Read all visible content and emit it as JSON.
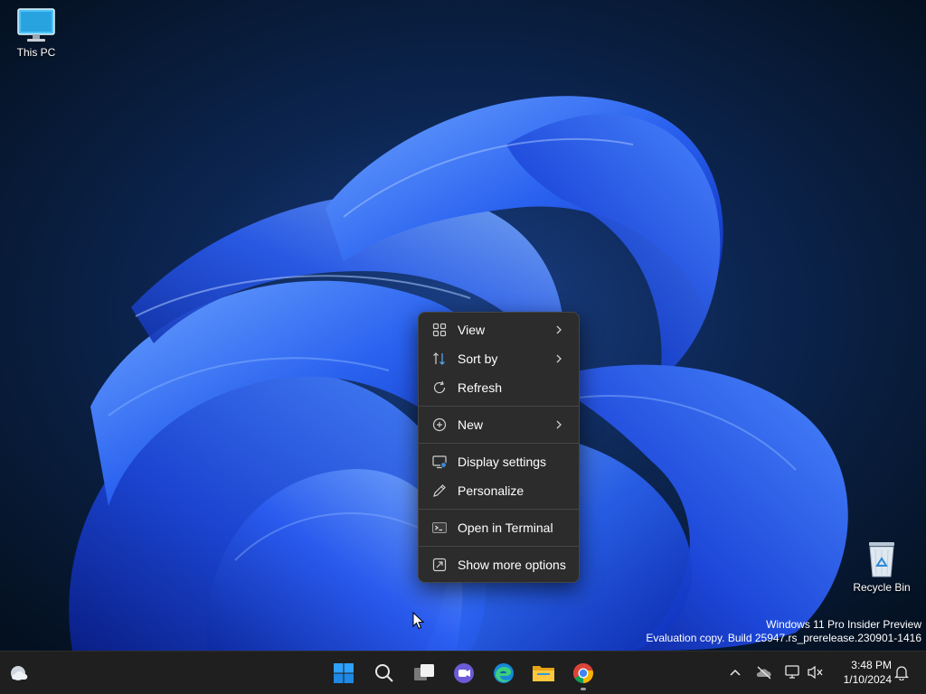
{
  "desktop": {
    "icons": [
      {
        "label": "This PC",
        "icon": "monitor-icon"
      },
      {
        "label": "Recycle Bin",
        "icon": "recycle-bin-icon"
      }
    ],
    "watermark": {
      "line1": "Windows 11 Pro Insider Preview",
      "line2": "Evaluation copy. Build 25947.rs_prerelease.230901-1416"
    }
  },
  "context_menu": {
    "items": [
      {
        "label": "View",
        "icon": "grid-icon",
        "submenu": true
      },
      {
        "label": "Sort by",
        "icon": "sort-icon",
        "submenu": true
      },
      {
        "label": "Refresh",
        "icon": "refresh-icon",
        "submenu": false
      },
      {
        "label": "New",
        "icon": "plus-circle-icon",
        "submenu": true
      },
      {
        "label": "Display settings",
        "icon": "display-settings-icon",
        "submenu": false
      },
      {
        "label": "Personalize",
        "icon": "pen-icon",
        "submenu": false
      },
      {
        "label": "Open in Terminal",
        "icon": "terminal-icon",
        "submenu": false
      },
      {
        "label": "Show more options",
        "icon": "more-options-icon",
        "submenu": false
      }
    ]
  },
  "taskbar": {
    "apps": [
      {
        "name": "Start",
        "icon": "windows-start-icon"
      },
      {
        "name": "Search",
        "icon": "search-icon"
      },
      {
        "name": "Task View",
        "icon": "task-view-icon"
      },
      {
        "name": "Chat",
        "icon": "chat-icon"
      },
      {
        "name": "Microsoft Edge",
        "icon": "edge-icon"
      },
      {
        "name": "File Explorer",
        "icon": "folder-icon"
      },
      {
        "name": "Google Chrome",
        "icon": "chrome-icon",
        "running": true
      }
    ],
    "tray": {
      "icons": [
        "chevron-up-icon",
        "onedrive-icon",
        "network-icon",
        "volume-muted-icon",
        "notification-bell-icon"
      ],
      "time": "3:48 PM",
      "date": "1/10/2024"
    }
  },
  "colors": {
    "wallpaper_bg": "#06152b",
    "bloom": "#1f55e8",
    "menu_bg": "#2c2c2c",
    "taskbar_bg": "#1f1f1f",
    "accent": "#0078d4"
  }
}
